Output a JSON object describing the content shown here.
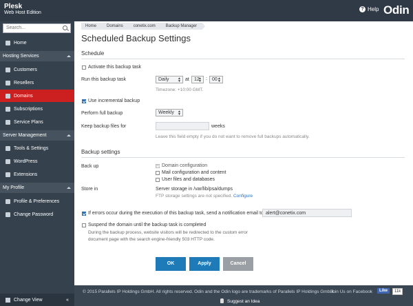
{
  "topbar": {
    "brand_line1": "Plesk",
    "brand_line2": "Web Host Edition",
    "help_label": "Help",
    "logo": "Odin"
  },
  "sidebar": {
    "search_placeholder": "Search...",
    "home": "Home",
    "hosting_services": "Hosting Services",
    "customers": "Customers",
    "resellers": "Resellers",
    "domains": "Domains",
    "subscriptions": "Subscriptions",
    "service_plans": "Service Plans",
    "server_management": "Server Management",
    "tools_settings": "Tools & Settings",
    "wordpress": "WordPress",
    "extensions": "Extensions",
    "my_profile": "My Profile",
    "profile_preferences": "Profile & Preferences",
    "change_password": "Change Password",
    "change_view": "Change View"
  },
  "breadcrumb": [
    "Home",
    "Domains",
    "conetix.com",
    "Backup Manager"
  ],
  "page_title": "Scheduled Backup Settings",
  "schedule": {
    "heading": "Schedule",
    "activate_label": "Activate this backup task",
    "run_label": "Run this backup task",
    "run_frequency": "Daily",
    "at_label": "at",
    "hour": "12",
    "minute": "00",
    "timezone": "Timezone: +10:00 GMT.",
    "incremental_label": "Use incremental backup",
    "full_backup_label": "Perform full backup",
    "full_backup_value": "Weekly",
    "keep_label": "Keep backup files for",
    "keep_value": "",
    "keep_unit": "weeks",
    "keep_hint": "Leave this field empty if you do not want to remove full backups automatically."
  },
  "backup_settings": {
    "heading": "Backup settings",
    "back_up_label": "Back up",
    "opt_domain_config": "Domain configuration",
    "opt_mail": "Mail configuration and content",
    "opt_files": "User files and databases",
    "store_in_label": "Store in",
    "store_value": "Server storage in /var/lib/psa/dumps",
    "ftp_text": "FTP storage settings are not specified.",
    "ftp_link": "Configure"
  },
  "notify": {
    "label": "If errors occur during the execution of this backup task, send a notification email to",
    "email": "alert@conetix.com",
    "suspend_label": "Suspend the domain until the backup task is completed",
    "suspend_hint_1": "During the backup process, website visitors will be redirected to the custom error",
    "suspend_hint_2": "document page with the search engine-friendly 503 HTTP code."
  },
  "buttons": {
    "ok": "OK",
    "apply": "Apply",
    "cancel": "Cancel"
  },
  "footer": {
    "copyright": "© 2015 Parallels IP Holdings GmbH. All rights reserved. Odin and the Odin logo are trademarks of Parallels IP Holdings GmbH.",
    "join": "Join Us on Facebook",
    "like": "Like",
    "like_count": "11k",
    "suggest": "Suggest an Idea"
  },
  "colors": {
    "sidebar_bg": "#35414d",
    "active": "#cc1f1f",
    "primary_button": "#1f7ab8",
    "accent": "#2f6fb5"
  }
}
